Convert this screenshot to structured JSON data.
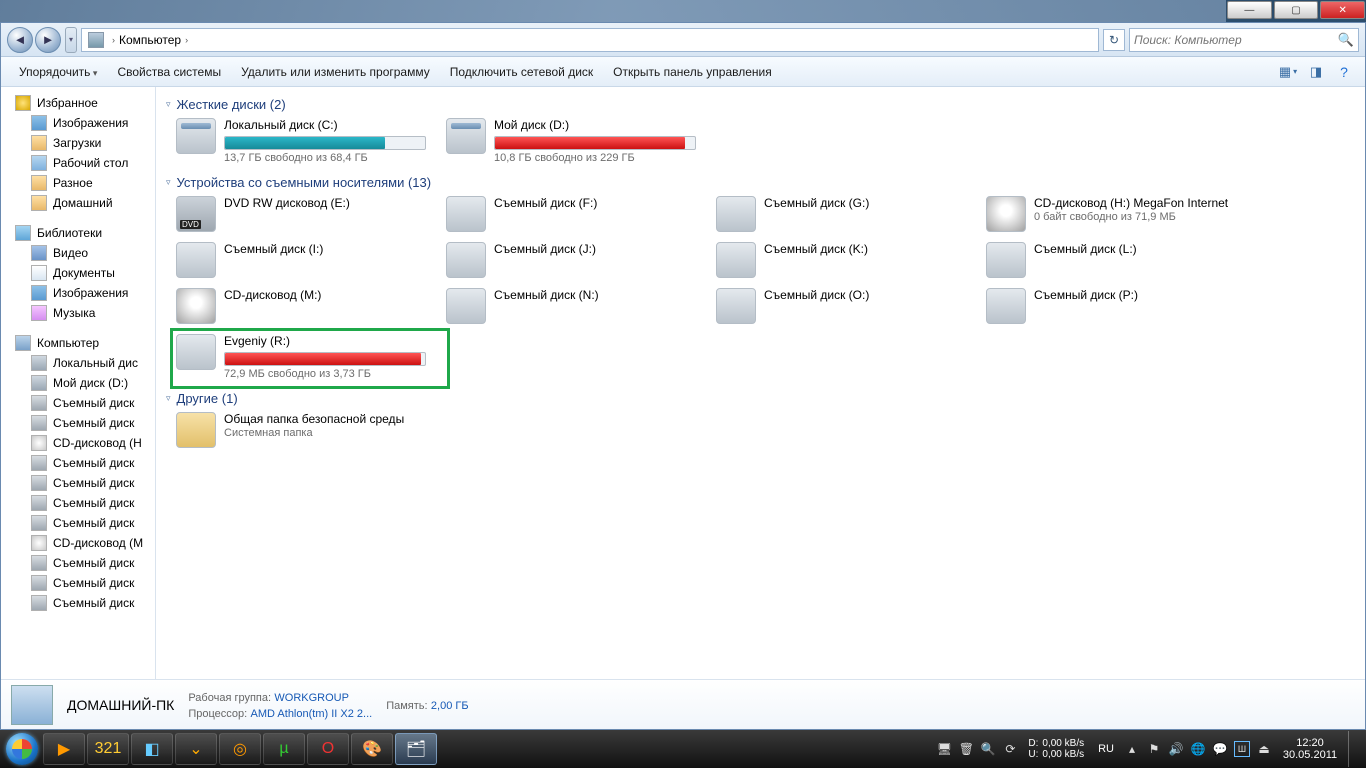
{
  "titlebar": {
    "min": "—",
    "max": "▢",
    "close": "✕"
  },
  "addressbar": {
    "back_glyph": "◄",
    "fwd_glyph": "►",
    "dd_glyph": "▾",
    "root": "Компьютер",
    "sep": "›",
    "refresh": "↻",
    "search_placeholder": "Поиск: Компьютер",
    "search_icon": "🔍"
  },
  "commands": {
    "organize": "Упорядочить",
    "sysprops": "Свойства системы",
    "uninstall": "Удалить или изменить программу",
    "mapdrive": "Подключить сетевой диск",
    "controlpanel": "Открыть панель управления"
  },
  "sidebar": {
    "favorites": "Избранное",
    "fav_items": [
      "Изображения",
      "Загрузки",
      "Рабочий стол",
      "Разное",
      "Домашний"
    ],
    "libraries": "Библиотеки",
    "lib_items": [
      "Видео",
      "Документы",
      "Изображения",
      "Музыка"
    ],
    "computer": "Компьютер",
    "drives": [
      "Локальный дис",
      "Мой диск (D:)",
      "Съемный диск",
      "Съемный диск",
      "CD-дисковод (H",
      "Съемный диск",
      "Съемный диск",
      "Съемный диск",
      "Съемный диск",
      "CD-дисковод (M",
      "Съемный диск",
      "Съемный диск",
      "Съемный диск"
    ]
  },
  "groups": {
    "hdd_label": "Жесткие диски (2)",
    "removable_label": "Устройства со съемными носителями (13)",
    "other_label": "Другие (1)"
  },
  "hdd": [
    {
      "name": "Локальный диск (C:)",
      "sub": "13,7 ГБ свободно из 68,4 ГБ",
      "pct": 80,
      "color": "teal"
    },
    {
      "name": "Мой диск (D:)",
      "sub": "10,8 ГБ свободно из 229 ГБ",
      "pct": 95,
      "color": "red"
    }
  ],
  "removable": [
    {
      "name": "DVD RW дисковод (E:)",
      "icon": "dvd",
      "badge": "DVD"
    },
    {
      "name": "Съемный диск (F:)"
    },
    {
      "name": "Съемный диск (G:)"
    },
    {
      "name": "CD-дисковод (H:) MegaFon Internet",
      "icon": "cd",
      "sub": "0 байт свободно из 71,9 МБ"
    },
    {
      "name": "Съемный диск (I:)"
    },
    {
      "name": "Съемный диск (J:)"
    },
    {
      "name": "Съемный диск (K:)"
    },
    {
      "name": "Съемный диск (L:)"
    },
    {
      "name": "CD-дисковод (M:)",
      "icon": "cd"
    },
    {
      "name": "Съемный диск (N:)"
    },
    {
      "name": "Съемный диск (O:)"
    },
    {
      "name": "Съемный диск (P:)"
    },
    {
      "name": "Evgeniy (R:)",
      "sub": "72,9 МБ свободно из 3,73 ГБ",
      "pct": 98,
      "color": "red",
      "highlight": true
    }
  ],
  "other": {
    "name": "Общая папка безопасной среды",
    "sub": "Системная папка"
  },
  "details": {
    "hostname": "ДОМАШНИЙ-ПК",
    "wg_label": "Рабочая группа:",
    "wg_val": "WORKGROUP",
    "cpu_label": "Процессор:",
    "cpu_val": "AMD Athlon(tm) II X2 2...",
    "mem_label": "Память:",
    "mem_val": "2,00 ГБ"
  },
  "taskbar": {
    "net": {
      "d_label": "D:",
      "u_label": "U:",
      "d_val": "0,00 kB/s",
      "u_val": "0,00 kB/s"
    },
    "lang": "RU",
    "time": "12:20",
    "date": "30.05.2011"
  }
}
